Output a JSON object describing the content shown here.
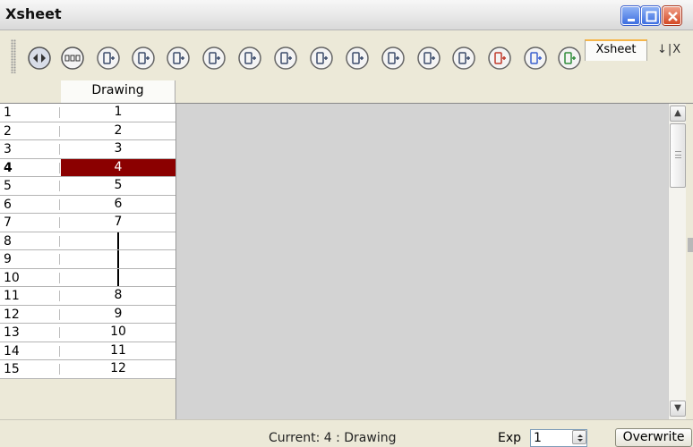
{
  "window": {
    "title": "Xsheet"
  },
  "toolbar": {
    "icons": [
      "onion-skin-icon",
      "light-table-icon",
      "drawing-thumbnail-icon",
      "add-column-icon",
      "remove-column-icon",
      "insert-drawing-icon",
      "add-drawing-icon",
      "add-exposure-icon",
      "remove-exposure-icon",
      "create-drawing-icon",
      "delete-drawing-icon",
      "duplicate-drawing-icon",
      "rename-drawing-icon",
      "clear-exposure-icon",
      "toggle-blue-icon",
      "toggle-green-icon"
    ],
    "tab_label": "Xsheet",
    "pin_close": "↓|X"
  },
  "column": {
    "header": "Drawing"
  },
  "rows": [
    {
      "num": "1",
      "value": "1"
    },
    {
      "num": "2",
      "value": "2"
    },
    {
      "num": "3",
      "value": "3"
    },
    {
      "num": "4",
      "value": "4",
      "current": true
    },
    {
      "num": "5",
      "value": "5"
    },
    {
      "num": "6",
      "value": "6"
    },
    {
      "num": "7",
      "value": "7"
    },
    {
      "num": "8",
      "value": "",
      "hold": true
    },
    {
      "num": "9",
      "value": "",
      "hold": true
    },
    {
      "num": "10",
      "value": "",
      "hold": true
    },
    {
      "num": "11",
      "value": "8"
    },
    {
      "num": "12",
      "value": "9"
    },
    {
      "num": "13",
      "value": "10"
    },
    {
      "num": "14",
      "value": "11"
    },
    {
      "num": "15",
      "value": "12"
    }
  ],
  "status": {
    "current": "Current: 4 : Drawing",
    "exp_label": "Exp",
    "exp_value": "1",
    "overwrite_label": "Overwrite"
  },
  "colors": {
    "current_cell": "#8b0000",
    "pane_gray": "#d3d3d3",
    "tab_accent": "#f6b64a"
  }
}
